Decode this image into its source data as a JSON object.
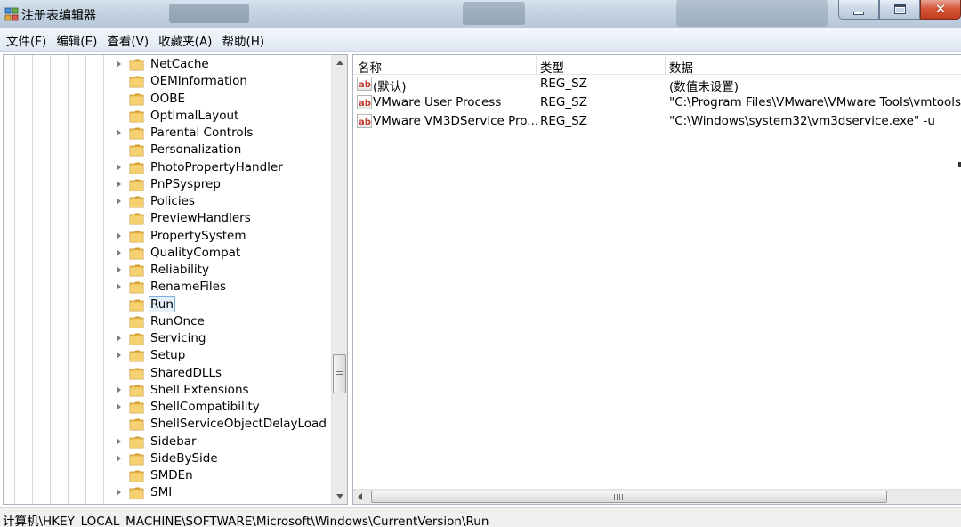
{
  "window": {
    "title": "注册表编辑器",
    "icon": "regedit-icon"
  },
  "menu": {
    "items": [
      {
        "label": "文件(F)"
      },
      {
        "label": "编辑(E)"
      },
      {
        "label": "查看(V)"
      },
      {
        "label": "收藏夹(A)"
      },
      {
        "label": "帮助(H)"
      }
    ]
  },
  "tree": {
    "items": [
      {
        "label": "NetCache",
        "expandable": true
      },
      {
        "label": "OEMInformation",
        "expandable": false
      },
      {
        "label": "OOBE",
        "expandable": false
      },
      {
        "label": "OptimalLayout",
        "expandable": false
      },
      {
        "label": "Parental Controls",
        "expandable": true
      },
      {
        "label": "Personalization",
        "expandable": false
      },
      {
        "label": "PhotoPropertyHandler",
        "expandable": true
      },
      {
        "label": "PnPSysprep",
        "expandable": true
      },
      {
        "label": "Policies",
        "expandable": true
      },
      {
        "label": "PreviewHandlers",
        "expandable": false
      },
      {
        "label": "PropertySystem",
        "expandable": true
      },
      {
        "label": "QualityCompat",
        "expandable": true
      },
      {
        "label": "Reliability",
        "expandable": true
      },
      {
        "label": "RenameFiles",
        "expandable": true
      },
      {
        "label": "Run",
        "expandable": false,
        "selected": true
      },
      {
        "label": "RunOnce",
        "expandable": false
      },
      {
        "label": "Servicing",
        "expandable": true
      },
      {
        "label": "Setup",
        "expandable": true
      },
      {
        "label": "SharedDLLs",
        "expandable": false
      },
      {
        "label": "Shell Extensions",
        "expandable": true
      },
      {
        "label": "ShellCompatibility",
        "expandable": true
      },
      {
        "label": "ShellServiceObjectDelayLoad",
        "expandable": false
      },
      {
        "label": "Sidebar",
        "expandable": true
      },
      {
        "label": "SideBySide",
        "expandable": true
      },
      {
        "label": "SMDEn",
        "expandable": false
      },
      {
        "label": "SMI",
        "expandable": true
      }
    ]
  },
  "values": {
    "columns": {
      "name": "名称",
      "type": "类型",
      "data": "数据"
    },
    "rows": [
      {
        "name": "(默认)",
        "type": "REG_SZ",
        "data": "(数值未设置)"
      },
      {
        "name": "VMware User Process",
        "type": "REG_SZ",
        "data": "\"C:\\Program Files\\VMware\\VMware Tools\\vmtoolsd.exe\" -n vmusr"
      },
      {
        "name": "VMware VM3DService Pro...",
        "type": "REG_SZ",
        "data": "\"C:\\Windows\\system32\\vm3dservice.exe\" -u"
      }
    ]
  },
  "status": {
    "path": "计算机\\HKEY_LOCAL_MACHINE\\SOFTWARE\\Microsoft\\Windows\\CurrentVersion\\Run"
  },
  "colors": {
    "folder": "#e8b33a",
    "selection_border": "#7fb0de",
    "selection_bg": "#e5f0fb",
    "close_button": "#c33d1f"
  }
}
